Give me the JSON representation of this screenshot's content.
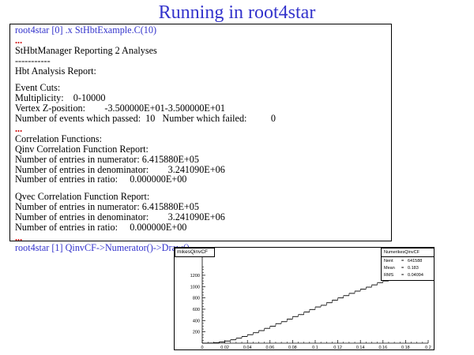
{
  "slide": {
    "title": "Running in root4star"
  },
  "terminal": {
    "lines": [
      {
        "text": "root4star [0] .x StHbtExample.C(10)",
        "style": "cmd"
      },
      {
        "text": "...",
        "style": "dots"
      },
      {
        "text": "StHbtManager Reporting 2 Analyses",
        "style": "normal"
      },
      {
        "text": "-----------",
        "style": "normal"
      },
      {
        "text": "Hbt Analysis Report:",
        "style": "normal"
      },
      {
        "text": "",
        "style": "blank"
      },
      {
        "text": "Event Cuts:",
        "style": "normal"
      },
      {
        "text": "Multiplicity:    0-10000",
        "style": "normal"
      },
      {
        "text": "Vertex Z-position:        -3.500000E+01-3.500000E+01",
        "style": "normal"
      },
      {
        "text": "Number of events which passed:  10   Number which failed:          0",
        "style": "normal"
      },
      {
        "text": "...",
        "style": "dots"
      },
      {
        "text": "Correlation Functions:",
        "style": "normal"
      },
      {
        "text": "Qinv Correlation Function Report:",
        "style": "normal"
      },
      {
        "text": "Number of entries in numerator: 6.415880E+05",
        "style": "normal"
      },
      {
        "text": "Number of entries in denominator:        3.241090E+06",
        "style": "normal"
      },
      {
        "text": "Number of entries in ratio:     0.000000E+00",
        "style": "normal"
      },
      {
        "text": "",
        "style": "blank"
      },
      {
        "text": "Qvec Correlation Function Report:",
        "style": "normal"
      },
      {
        "text": "Number of entries in numerator: 6.415880E+05",
        "style": "normal"
      },
      {
        "text": "Number of entries in denominator:        3.241090E+06",
        "style": "normal"
      },
      {
        "text": "Number of entries in ratio:     0.000000E+00",
        "style": "normal"
      },
      {
        "text": "...",
        "style": "dots"
      },
      {
        "text": "root4star [1] QinvCF->Numerator()->Draw()",
        "style": "cmd"
      }
    ]
  },
  "histogram": {
    "label": "mikesQinvCF",
    "stats": {
      "title": "NumerikesQinvCF",
      "rows": [
        {
          "key": "Nent",
          "value": "641588"
        },
        {
          "key": "Mean",
          "value": "0.183"
        },
        {
          "key": "RMS",
          "value": "0.04094"
        }
      ]
    },
    "chart_data": {
      "type": "line",
      "x": [
        0.0025,
        0.0075,
        0.0125,
        0.0175,
        0.0225,
        0.0275,
        0.0325,
        0.0375,
        0.0425,
        0.0475,
        0.0525,
        0.0575,
        0.0625,
        0.0675,
        0.0725,
        0.0775,
        0.0825,
        0.0875,
        0.0925,
        0.0975,
        0.1025,
        0.1075,
        0.1125,
        0.1175,
        0.1225,
        0.1275,
        0.1325,
        0.1375,
        0.1425,
        0.1475,
        0.1525,
        0.1575,
        0.1625,
        0.1675,
        0.1725,
        0.1775
      ],
      "values": [
        0,
        2,
        8,
        20,
        38,
        60,
        88,
        118,
        150,
        185,
        222,
        262,
        300,
        345,
        380,
        425,
        470,
        505,
        550,
        595,
        640,
        670,
        715,
        760,
        800,
        840,
        880,
        920,
        955,
        990,
        1030,
        1070,
        1100,
        1130,
        1160,
        1170
      ],
      "title": "",
      "xlabel": "",
      "ylabel": "",
      "xlim": [
        0,
        0.2
      ],
      "ylim": [
        0,
        1450
      ],
      "x_ticks": [
        "0",
        "0.02",
        "0.04",
        "0.06",
        "0.08",
        "0.1",
        "0.12",
        "0.14",
        "0.16",
        "0.18",
        "0.2"
      ],
      "y_ticks": [
        "200",
        "400",
        "600",
        "800",
        "1000",
        "1200"
      ],
      "grid": false
    }
  }
}
